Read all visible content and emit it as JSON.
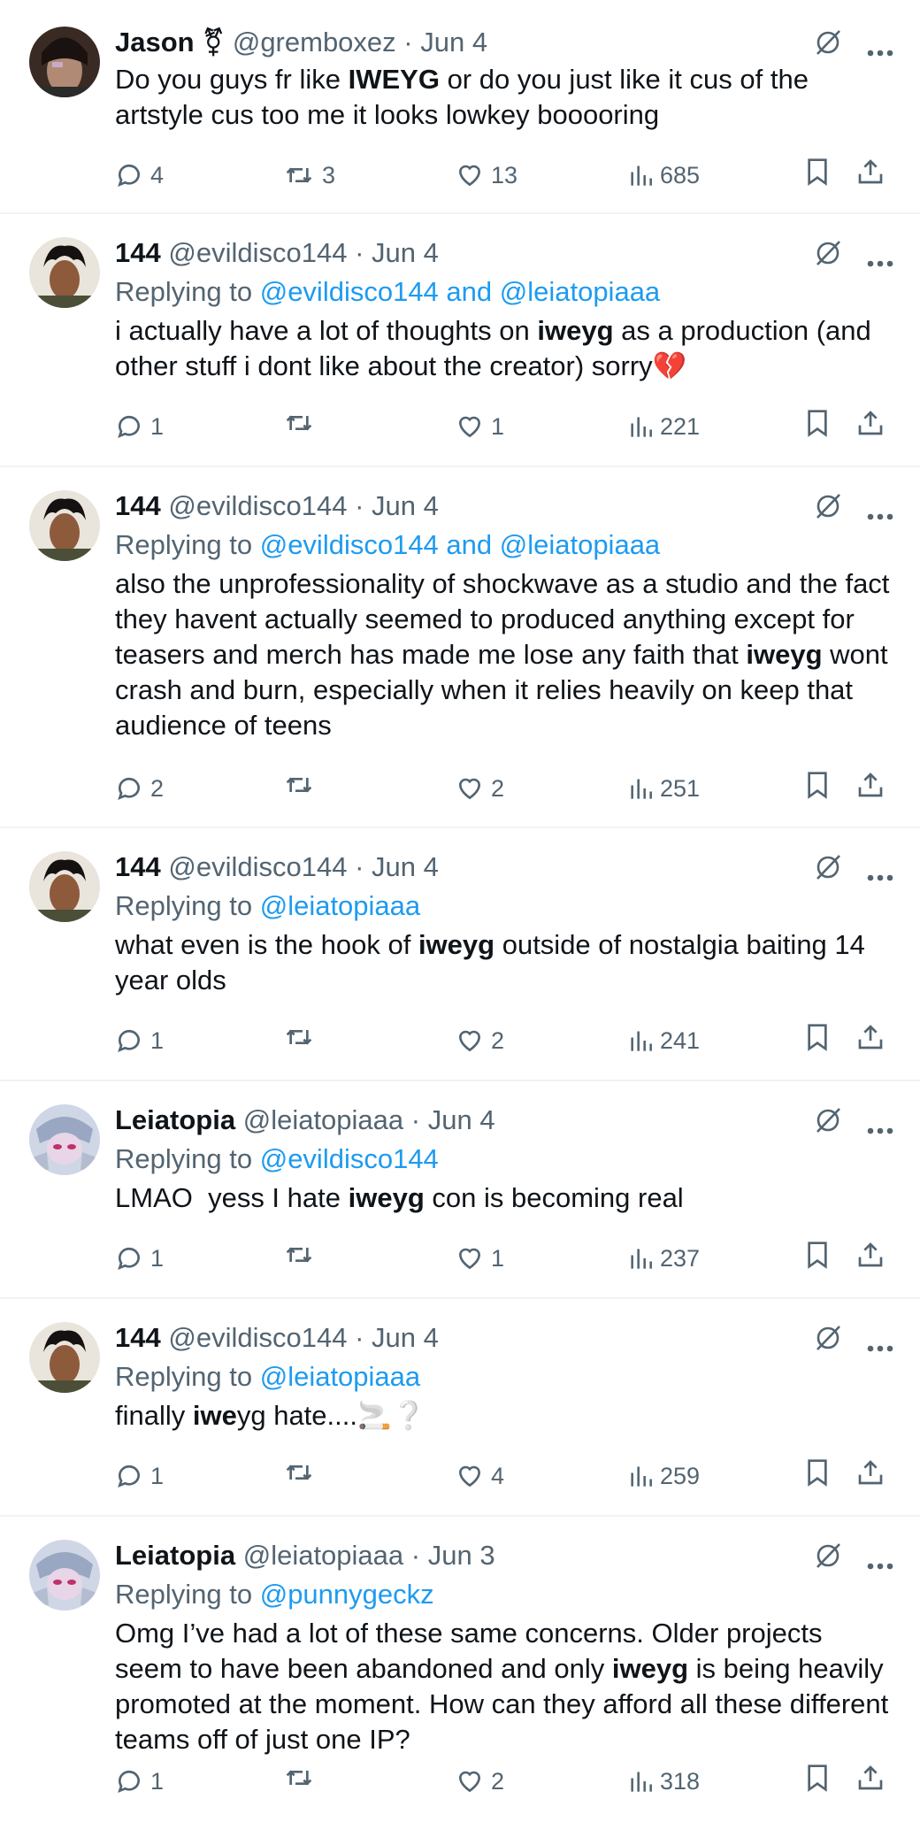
{
  "tweets": [
    {
      "name": "Jason",
      "name_suffix": "⚧",
      "handle": "@gremboxez",
      "date": "Jun 4",
      "replying_label": "",
      "replying_to": "",
      "text": [
        {
          "t": "Do you guys fr like ",
          "b": false
        },
        {
          "t": "IWEYG",
          "b": true
        },
        {
          "t": " or do you just like it cus of the artstyle cus too me it looks lowkey booooring",
          "b": false
        }
      ],
      "replies": "4",
      "retweets": "3",
      "likes": "13",
      "views": "685",
      "avatar": "jason"
    },
    {
      "name": "144",
      "name_suffix": "",
      "handle": "@evildisco144",
      "date": "Jun 4",
      "replying_label": "Replying to ",
      "replying_to": "@evildisco144 and @leiatopiaaa",
      "text": [
        {
          "t": "i actually have a lot of thoughts on ",
          "b": false
        },
        {
          "t": "iweyg",
          "b": true
        },
        {
          "t": " as a production (and other stuff i dont like about the creator) sorry💔",
          "b": false
        }
      ],
      "replies": "1",
      "retweets": "",
      "likes": "1",
      "views": "221",
      "avatar": "144"
    },
    {
      "name": "144",
      "name_suffix": "",
      "handle": "@evildisco144",
      "date": "Jun 4",
      "replying_label": "Replying to ",
      "replying_to": "@evildisco144 and @leiatopiaaa",
      "text": [
        {
          "t": "also the unprofessionality of shockwave as a studio and the fact they havent actually seemed to produced anything except for teasers and merch has made me lose any faith that ",
          "b": false
        },
        {
          "t": "iweyg",
          "b": true
        },
        {
          "t": " wont crash and burn, especially when it relies heavily on keep that audience of teens",
          "b": false
        }
      ],
      "replies": "2",
      "retweets": "",
      "likes": "2",
      "views": "251",
      "avatar": "144"
    },
    {
      "name": "144",
      "name_suffix": "",
      "handle": "@evildisco144",
      "date": "Jun 4",
      "replying_label": "Replying to ",
      "replying_to": "@leiatopiaaa",
      "text": [
        {
          "t": "what even is the hook of ",
          "b": false
        },
        {
          "t": "iweyg",
          "b": true
        },
        {
          "t": " outside of nostalgia baiting 14 year olds",
          "b": false
        }
      ],
      "replies": "1",
      "retweets": "",
      "likes": "2",
      "views": "241",
      "avatar": "144"
    },
    {
      "name": "Leiatopia",
      "name_suffix": "",
      "handle": "@leiatopiaaa",
      "date": "Jun 4",
      "replying_label": "Replying to ",
      "replying_to": "@evildisco144",
      "text": [
        {
          "t": "LMAO  yess I hate ",
          "b": false
        },
        {
          "t": "iweyg",
          "b": true
        },
        {
          "t": " con is becoming real",
          "b": false
        }
      ],
      "replies": "1",
      "retweets": "",
      "likes": "1",
      "views": "237",
      "avatar": "leia"
    },
    {
      "name": "144",
      "name_suffix": "",
      "handle": "@evildisco144",
      "date": "Jun 4",
      "replying_label": "Replying to ",
      "replying_to": "@leiatopiaaa",
      "text": [
        {
          "t": "finally ",
          "b": false
        },
        {
          "t": "iwe",
          "b": true
        },
        {
          "t": "yg hate....🚬❔",
          "b": false
        }
      ],
      "replies": "1",
      "retweets": "",
      "likes": "4",
      "views": "259",
      "avatar": "144"
    },
    {
      "name": "Leiatopia",
      "name_suffix": "",
      "handle": "@leiatopiaaa",
      "date": "Jun 3",
      "replying_label": "Replying to ",
      "replying_to": "@punnygeckz",
      "text": [
        {
          "t": "Omg I’ve had a lot of these same concerns. Older projects seem to have been abandoned and only ",
          "b": false
        },
        {
          "t": "iweyg",
          "b": true
        },
        {
          "t": " is being heavily promoted at the moment. How can they afford all these different teams off of just one IP?",
          "b": false
        }
      ],
      "replies": "1",
      "retweets": "",
      "likes": "2",
      "views": "318",
      "avatar": "leia"
    }
  ],
  "icons": {
    "reply": "reply-icon",
    "retweet": "retweet-icon",
    "like": "heart-icon",
    "views": "views-icon",
    "bookmark": "bookmark-icon",
    "share": "share-icon",
    "grok": "grok-icon",
    "more": "more-icon"
  },
  "colors": {
    "text": "#0f1419",
    "muted": "#536471",
    "link": "#1d9bf0",
    "divider": "#eff3f4"
  }
}
